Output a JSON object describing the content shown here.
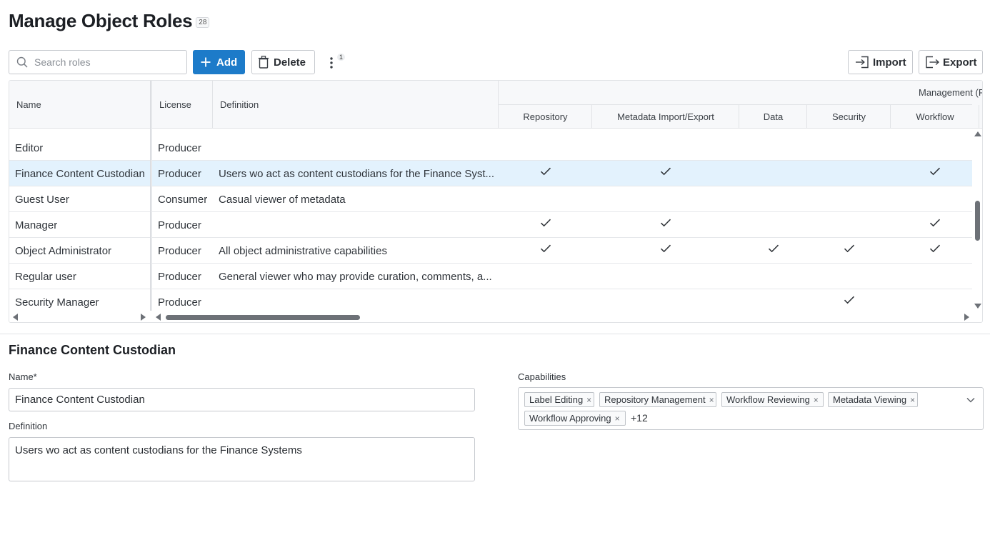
{
  "page": {
    "title": "Manage Object Roles",
    "count": "28"
  },
  "toolbar": {
    "search_placeholder": "Search roles",
    "add_label": "Add",
    "delete_label": "Delete",
    "more_badge": "1",
    "import_label": "Import",
    "export_label": "Export"
  },
  "grid": {
    "columns": {
      "name": "Name",
      "license": "License",
      "definition": "Definition",
      "group": "Management (P",
      "repository": "Repository",
      "metadata": "Metadata Import/Export",
      "data": "Data",
      "security": "Security",
      "workflow": "Workflow"
    },
    "rows": [
      {
        "name": "Editor",
        "license": "Producer",
        "definition": "",
        "repository": false,
        "metadata": false,
        "data": false,
        "security": false,
        "workflow": false,
        "selected": false
      },
      {
        "name": "Finance Content Custodian",
        "license": "Producer",
        "definition": "Users wo act as content custodians for the Finance Syst...",
        "repository": true,
        "metadata": true,
        "data": false,
        "security": false,
        "workflow": true,
        "selected": true
      },
      {
        "name": "Guest User",
        "license": "Consumer",
        "definition": "Casual viewer of metadata",
        "repository": false,
        "metadata": false,
        "data": false,
        "security": false,
        "workflow": false,
        "selected": false
      },
      {
        "name": "Manager",
        "license": "Producer",
        "definition": "",
        "repository": true,
        "metadata": true,
        "data": false,
        "security": false,
        "workflow": true,
        "selected": false
      },
      {
        "name": "Object Administrator",
        "license": "Producer",
        "definition": "All object administrative capabilities",
        "repository": true,
        "metadata": true,
        "data": true,
        "security": true,
        "workflow": true,
        "selected": false
      },
      {
        "name": "Regular user",
        "license": "Producer",
        "definition": "General viewer who may provide curation, comments, a...",
        "repository": false,
        "metadata": false,
        "data": false,
        "security": false,
        "workflow": false,
        "selected": false
      },
      {
        "name": "Security Manager",
        "license": "Producer",
        "definition": "",
        "repository": false,
        "metadata": false,
        "data": false,
        "security": true,
        "workflow": false,
        "selected": false
      }
    ]
  },
  "detail": {
    "title": "Finance Content Custodian",
    "name_label": "Name*",
    "name_value": "Finance Content Custodian",
    "definition_label": "Definition",
    "definition_value": "Users wo act as content custodians for the Finance Systems",
    "capabilities_label": "Capabilities",
    "capabilities": [
      "Label Editing",
      "Repository Management",
      "Workflow Reviewing",
      "Metadata Viewing",
      "Workflow Approving"
    ],
    "capabilities_more": "+12"
  },
  "colors": {
    "accent": "#1d7bc9",
    "selected_row": "#e3f2fd"
  }
}
